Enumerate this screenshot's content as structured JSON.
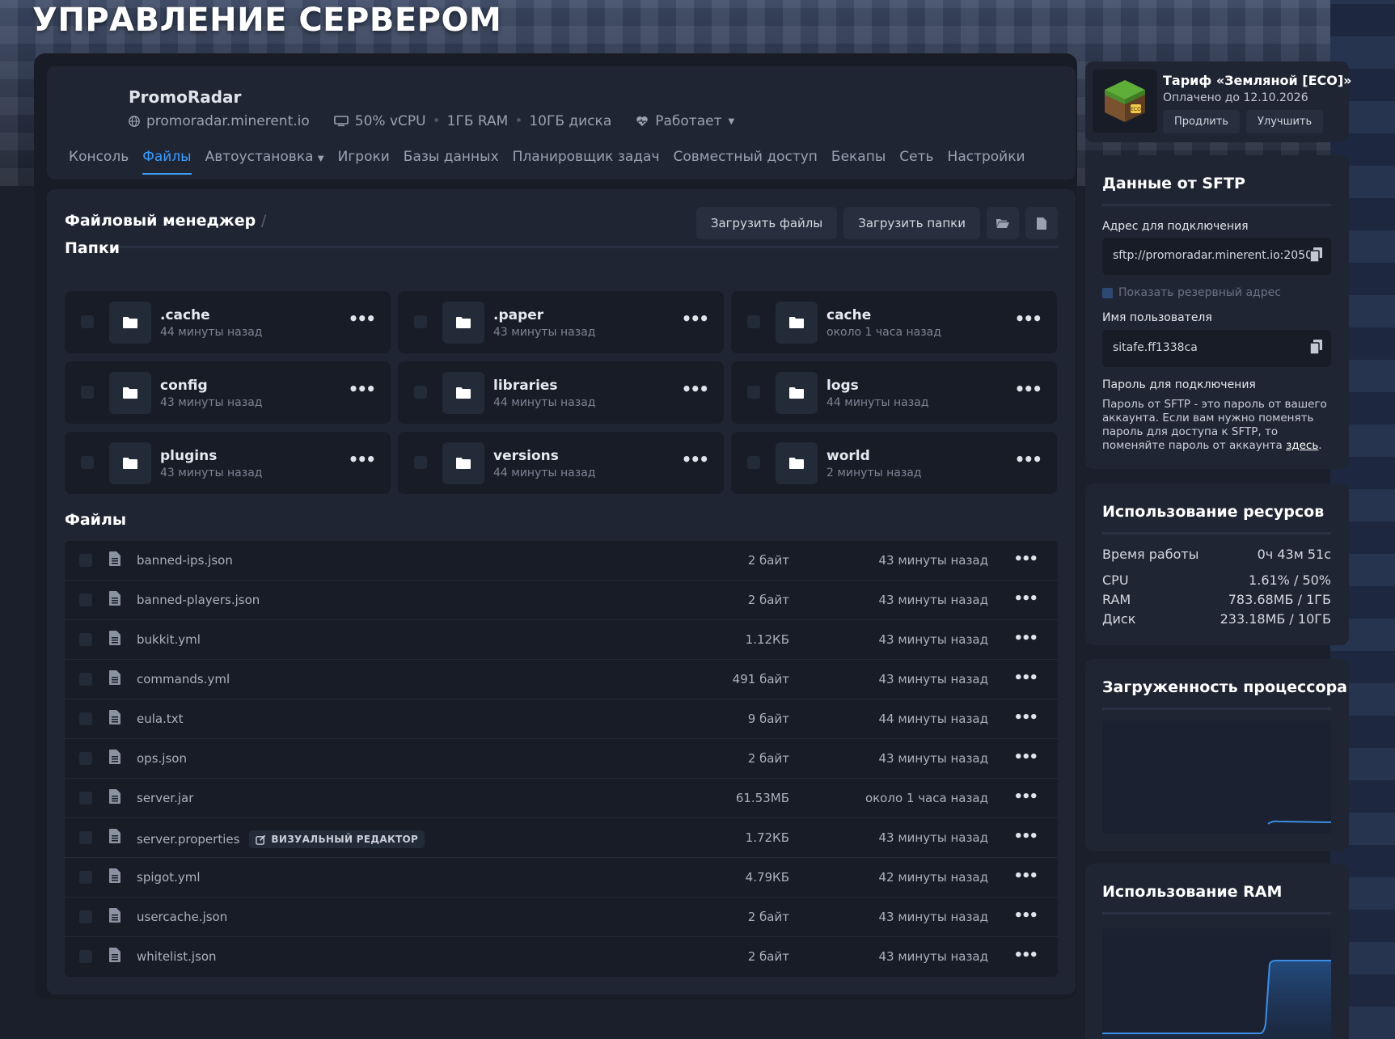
{
  "page": {
    "title": "УПРАВЛЕНИЕ СЕРВЕРОМ"
  },
  "server": {
    "name": "PromoRadar",
    "domain": "promoradar.minerent.io",
    "cpu": "50% vCPU",
    "ram": "1ГБ RAM",
    "disk": "10ГБ диска",
    "status": "Работает"
  },
  "tabs": [
    {
      "label": "Консоль"
    },
    {
      "label": "Файлы",
      "active": true
    },
    {
      "label": "Автоустановка"
    },
    {
      "label": "Игроки"
    },
    {
      "label": "Базы данных"
    },
    {
      "label": "Планировщик задач"
    },
    {
      "label": "Совместный доступ"
    },
    {
      "label": "Бекапы"
    },
    {
      "label": "Сеть"
    },
    {
      "label": "Настройки"
    }
  ],
  "file_manager": {
    "title": "Файловый менеджер",
    "path_sep": "/",
    "upload_files": "Загрузить файлы",
    "upload_folders": "Загрузить папки",
    "folders_label": "Папки",
    "files_label": "Файлы",
    "folders": [
      {
        "name": ".cache",
        "time": "44 минуты назад"
      },
      {
        "name": ".paper",
        "time": "43 минуты назад"
      },
      {
        "name": "cache",
        "time": "около 1 часа назад"
      },
      {
        "name": "config",
        "time": "43 минуты назад"
      },
      {
        "name": "libraries",
        "time": "44 минуты назад"
      },
      {
        "name": "logs",
        "time": "44 минуты назад"
      },
      {
        "name": "plugins",
        "time": "43 минуты назад"
      },
      {
        "name": "versions",
        "time": "44 минуты назад"
      },
      {
        "name": "world",
        "time": "2 минуты назад"
      }
    ],
    "visual_editor_label": "ВИЗУАЛЬНЫЙ РЕДАКТОР",
    "files": [
      {
        "name": "banned-ips.json",
        "size": "2 байт",
        "time": "43 минуты назад"
      },
      {
        "name": "banned-players.json",
        "size": "2 байт",
        "time": "43 минуты назад"
      },
      {
        "name": "bukkit.yml",
        "size": "1.12КБ",
        "time": "43 минуты назад"
      },
      {
        "name": "commands.yml",
        "size": "491 байт",
        "time": "43 минуты назад"
      },
      {
        "name": "eula.txt",
        "size": "9 байт",
        "time": "44 минуты назад"
      },
      {
        "name": "ops.json",
        "size": "2 байт",
        "time": "43 минуты назад"
      },
      {
        "name": "server.jar",
        "size": "61.53МБ",
        "time": "около 1 часа назад"
      },
      {
        "name": "server.properties",
        "size": "1.72КБ",
        "time": "43 минуты назад",
        "visual_editor": true
      },
      {
        "name": "spigot.yml",
        "size": "4.79КБ",
        "time": "42 минуты назад"
      },
      {
        "name": "usercache.json",
        "size": "2 байт",
        "time": "43 минуты назад"
      },
      {
        "name": "whitelist.json",
        "size": "2 байт",
        "time": "43 минуты назад"
      }
    ]
  },
  "tariff": {
    "name": "Тариф «Земляной [ECO]»",
    "paid_until": "Оплачено до 12.10.2026",
    "renew": "Продлить",
    "upgrade": "Улучшить",
    "badge": "ECO"
  },
  "sftp": {
    "title": "Данные от SFTP",
    "address_label": "Адрес для подключения",
    "address": "sftp://promoradar.minerent.io:2050",
    "show_backup": "Показать резервный адрес",
    "username_label": "Имя пользователя",
    "username": "sitafe.ff1338ca",
    "password_label": "Пароль для подключения",
    "password_note": "Пароль от SFTP - это пароль от вашего аккаунта. Если вам нужно поменять пароль для доступа к SFTP, то поменяйте пароль от аккаунта ",
    "password_link": "здесь",
    "password_end": "."
  },
  "resources": {
    "title": "Использование ресурсов",
    "rows": [
      {
        "label": "Время работы",
        "value": "0ч 43м 51с"
      },
      {
        "label": "CPU",
        "value": "1.61% / 50%"
      },
      {
        "label": "RAM",
        "value": "783.68МБ / 1ГБ"
      },
      {
        "label": "Диск",
        "value": "233.18МБ / 10ГБ"
      }
    ]
  },
  "cpu_load": {
    "title": "Загруженность процессора"
  },
  "ram_usage": {
    "title": "Использование RAM"
  },
  "colors": {
    "accent": "#3b9dff",
    "bg": "#1a1f2b",
    "card": "#1f2533",
    "inner": "#171c26"
  }
}
